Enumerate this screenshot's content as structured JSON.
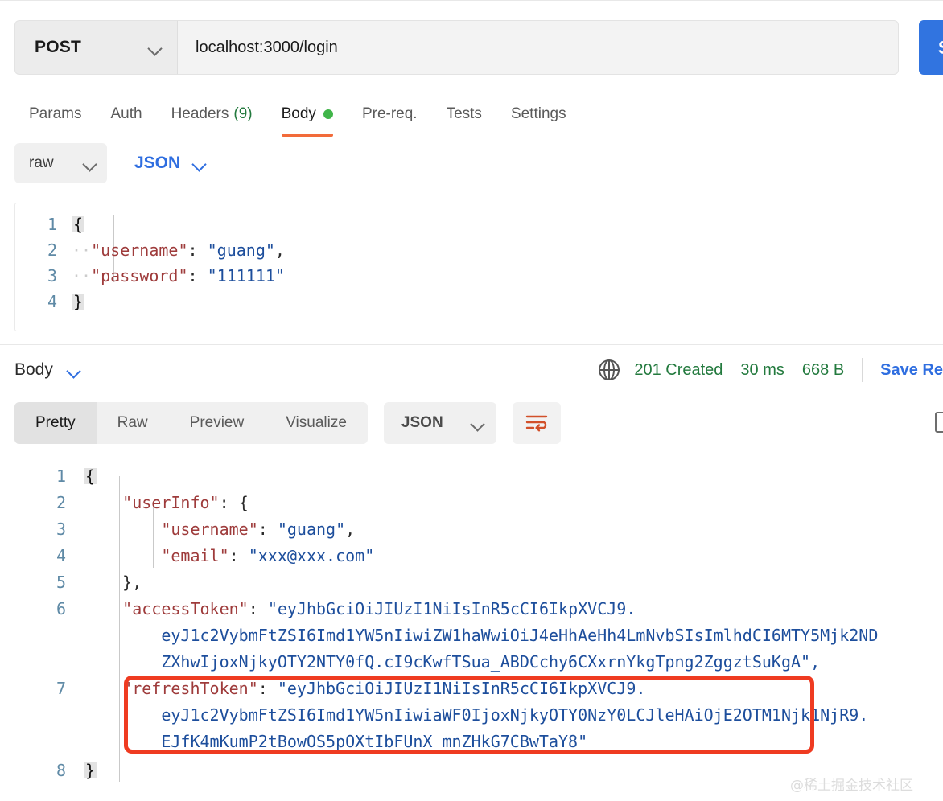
{
  "request": {
    "method": "POST",
    "url": "localhost:3000/login",
    "send_label": "Send",
    "tabs": [
      {
        "label": "Params",
        "count": "",
        "active": false,
        "dot": false
      },
      {
        "label": "Auth",
        "count": "",
        "active": false,
        "dot": false
      },
      {
        "label": "Headers",
        "count": "(9)",
        "active": false,
        "dot": false
      },
      {
        "label": "Body",
        "count": "",
        "active": true,
        "dot": true
      },
      {
        "label": "Pre-req.",
        "count": "",
        "active": false,
        "dot": false
      },
      {
        "label": "Tests",
        "count": "",
        "active": false,
        "dot": false
      },
      {
        "label": "Settings",
        "count": "",
        "active": false,
        "dot": false
      }
    ],
    "body_mode": "raw",
    "body_format": "JSON",
    "editor_lines": [
      {
        "num": "1",
        "indent": "",
        "fold": "{",
        "text": ""
      },
      {
        "num": "2",
        "indent": "··",
        "fold": "",
        "key": "\"username\"",
        "sep": ": ",
        "value": "\"guang\"",
        "tail": ","
      },
      {
        "num": "3",
        "indent": "··",
        "fold": "",
        "key": "\"password\"",
        "sep": ": ",
        "value": "\"111111\"",
        "tail": ""
      },
      {
        "num": "4",
        "indent": "",
        "fold": "}",
        "text": ""
      }
    ]
  },
  "response": {
    "section_label": "Body",
    "status": "201 Created",
    "time": "30 ms",
    "size": "668 B",
    "save_label": "Save Re",
    "view_tabs": [
      {
        "label": "Pretty",
        "active": true
      },
      {
        "label": "Raw",
        "active": false
      },
      {
        "label": "Preview",
        "active": false
      },
      {
        "label": "Visualize",
        "active": false
      }
    ],
    "format": "JSON",
    "wrap_icon": "wrap-lines-icon",
    "globe_icon": "globe-icon",
    "body_lines": [
      {
        "num": "1",
        "segments": [
          {
            "t": "{",
            "c": "fold"
          }
        ]
      },
      {
        "num": "2",
        "segments": [
          {
            "t": "    ",
            "c": "p"
          },
          {
            "t": "\"userInfo\"",
            "c": "k"
          },
          {
            "t": ": ",
            "c": "p"
          },
          {
            "t": "{",
            "c": "p"
          }
        ]
      },
      {
        "num": "3",
        "segments": [
          {
            "t": "        ",
            "c": "p"
          },
          {
            "t": "\"username\"",
            "c": "k"
          },
          {
            "t": ": ",
            "c": "p"
          },
          {
            "t": "\"guang\"",
            "c": "s"
          },
          {
            "t": ",",
            "c": "p"
          }
        ]
      },
      {
        "num": "4",
        "segments": [
          {
            "t": "        ",
            "c": "p"
          },
          {
            "t": "\"email\"",
            "c": "k"
          },
          {
            "t": ": ",
            "c": "p"
          },
          {
            "t": "\"xxx@xxx.com\"",
            "c": "s"
          }
        ]
      },
      {
        "num": "5",
        "segments": [
          {
            "t": "    ",
            "c": "p"
          },
          {
            "t": "},",
            "c": "p"
          }
        ]
      },
      {
        "num": "6",
        "segments": [
          {
            "t": "    ",
            "c": "p"
          },
          {
            "t": "\"accessToken\"",
            "c": "k"
          },
          {
            "t": ": ",
            "c": "p"
          },
          {
            "t": "\"eyJhbGciOiJIUzI1NiIsInR5cCI6IkpXVCJ9.",
            "c": "s"
          }
        ]
      },
      {
        "num": "",
        "segments": [
          {
            "t": "        ",
            "c": "p"
          },
          {
            "t": "eyJ1c2VybmFtZSI6Imd1YW5nIiwiZW1haWwiOiJ4eHhAeHh4LmNvbSIsImlhdCI6MTY5Mjk2ND",
            "c": "s"
          }
        ]
      },
      {
        "num": "",
        "segments": [
          {
            "t": "        ",
            "c": "p"
          },
          {
            "t": "ZXhwIjoxNjkyOTY2NTY0fQ.cI9cKwfTSua_ABDCchy6CXxrnYkgTpng2ZggztSuKgA\",",
            "c": "s"
          }
        ]
      },
      {
        "num": "7",
        "segments": [
          {
            "t": "    ",
            "c": "p"
          },
          {
            "t": "\"refreshToken\"",
            "c": "k"
          },
          {
            "t": ": ",
            "c": "p"
          },
          {
            "t": "\"eyJhbGciOiJIUzI1NiIsInR5cCI6IkpXVCJ9.",
            "c": "s"
          }
        ]
      },
      {
        "num": "",
        "segments": [
          {
            "t": "        ",
            "c": "p"
          },
          {
            "t": "eyJ1c2VybmFtZSI6Imd1YW5nIiwiaWF0IjoxNjkyOTY0NzY0LCJleHAiOjE2OTM1Njk1NjR9.",
            "c": "s"
          }
        ]
      },
      {
        "num": "",
        "segments": [
          {
            "t": "        ",
            "c": "p"
          },
          {
            "t": "EJfK4mKumP2tBowOS5pOXtIbFUnX_mnZHkG7CBwTaY8\"",
            "c": "s"
          }
        ]
      },
      {
        "num": "8",
        "segments": [
          {
            "t": "}",
            "c": "fold"
          }
        ]
      }
    ],
    "highlight_note": "refreshToken highlighted with red rounded rectangle"
  },
  "watermark": "@稀土掘金技术社区",
  "colors": {
    "accent_blue": "#2f6ee0",
    "send_blue": "#3174e0",
    "status_green": "#237a3e",
    "tab_underline_orange": "#f26b3a",
    "highlight_red": "#ef3b21",
    "json_key_red": "#9e3b3b",
    "json_string_blue": "#1d4e9c",
    "gutter_blue": "#5f8aa6"
  }
}
